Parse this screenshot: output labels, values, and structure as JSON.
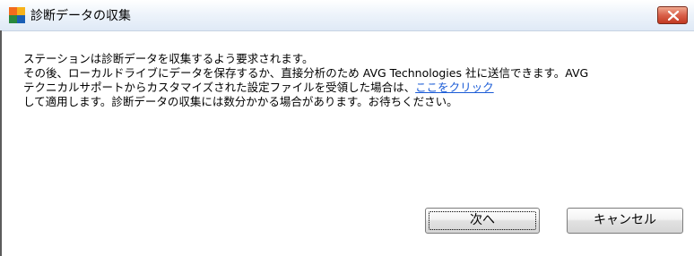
{
  "window": {
    "title": "診断データの収集",
    "colors": {
      "accent_link": "#1a5bd6",
      "close_button": "#c23a22"
    }
  },
  "icons": {
    "app": "avg-logo-icon",
    "close": "close-icon"
  },
  "message": {
    "line1": "ステーションは診断データを収集するよう要求されます。",
    "line2": "その後、ローカルドライブにデータを保存するか、直接分析のため AVG Technologies 社に送信できます。AVG",
    "line3_prefix": "テクニカルサポートからカスタマイズされた設定ファイルを受領した場合は、",
    "link": "ここをクリック",
    "line4": "して適用します。診断データの収集には数分かかる場合があります。お待ちください。"
  },
  "buttons": {
    "next": "次へ",
    "cancel": "キャンセル"
  }
}
